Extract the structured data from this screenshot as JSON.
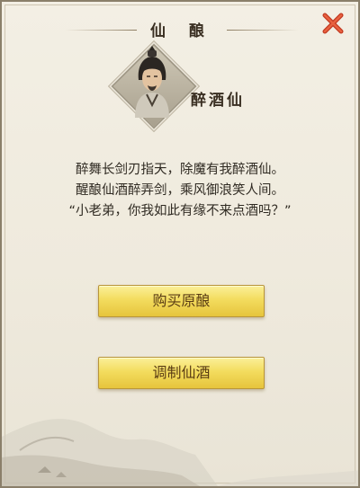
{
  "header": {
    "title": "仙 酿"
  },
  "npc": {
    "name": "醉酒仙"
  },
  "dialog": {
    "lines": [
      "醉舞长剑刃指天，除魔有我醉酒仙。",
      "醒酿仙酒醉弄剑，乘风御浪笑人间。",
      "“小老弟，你我如此有缘不来点酒吗？”"
    ]
  },
  "buttons": {
    "buy": "购买原酿",
    "brew": "调制仙酒"
  },
  "icons": {
    "close": "close-icon"
  },
  "colors": {
    "close": "#d6452a",
    "button_gold": "#f3dc5e",
    "panel": "#efeadd"
  }
}
